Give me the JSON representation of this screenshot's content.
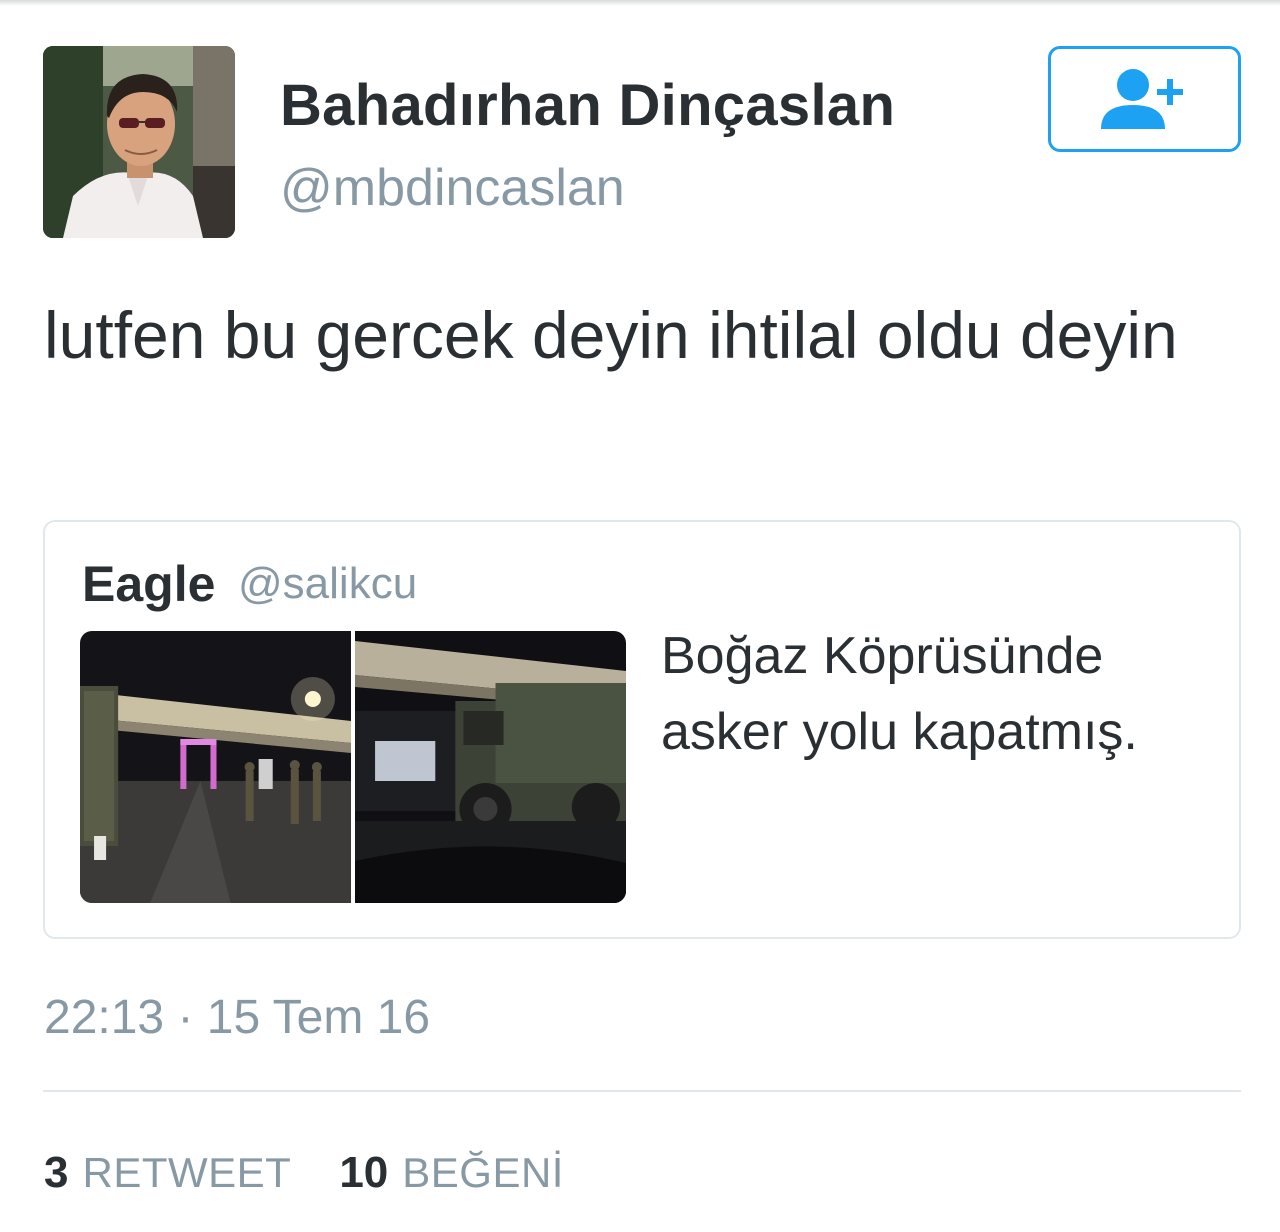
{
  "user": {
    "display_name": "Bahadırhan Dinçaslan",
    "handle": "@mbdincaslan",
    "avatar": "profile-photo"
  },
  "follow_button": {
    "icon": "add-user-icon",
    "color": "#1da1f2"
  },
  "tweet": {
    "text": "lutfen bu gercek deyin ihtilal oldu deyin",
    "timestamp": "22:13 · 15 Tem 16"
  },
  "quoted_tweet": {
    "name": "Eagle",
    "handle": "@salikcu",
    "text": "Boğaz Köprüsünde asker yolu kapatmış.",
    "photos": [
      "bridge-soldiers-photo",
      "military-truck-photo"
    ]
  },
  "stats": {
    "retweets": {
      "count": "3",
      "label": "RETWEET"
    },
    "likes": {
      "count": "10",
      "label": "BEĞENİ"
    }
  },
  "colors": {
    "text_primary": "#292f33",
    "text_secondary": "#8899a6",
    "border": "#e1e8ed",
    "accent": "#1da1f2"
  }
}
